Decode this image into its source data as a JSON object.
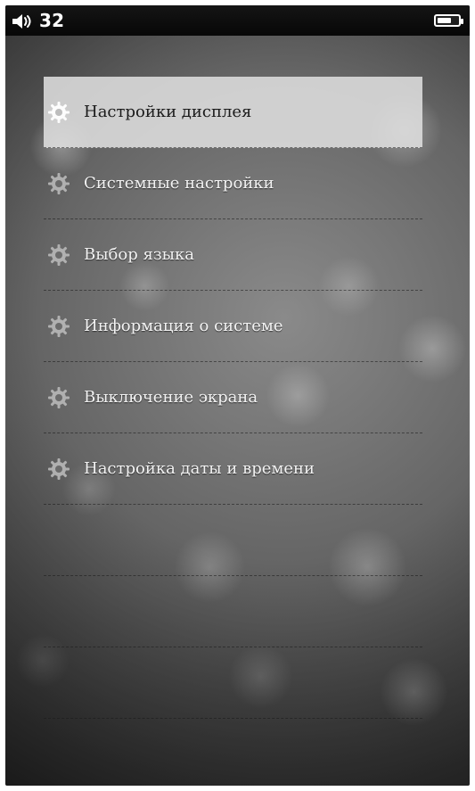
{
  "status_bar": {
    "volume_level": "32",
    "icons": {
      "speaker": "speaker-icon",
      "battery": "battery-icon"
    },
    "battery_fill_fraction": 0.7
  },
  "menu": {
    "items": [
      {
        "label": "Настройки дисплея",
        "icon": "gear-icon",
        "selected": true
      },
      {
        "label": "Системные настройки",
        "icon": "gear-icon",
        "selected": false
      },
      {
        "label": "Выбор языка",
        "icon": "gear-icon",
        "selected": false
      },
      {
        "label": "Информация о системе",
        "icon": "gear-icon",
        "selected": false
      },
      {
        "label": "Выключение экрана",
        "icon": "gear-icon",
        "selected": false
      },
      {
        "label": "Настройка даты и времени",
        "icon": "gear-icon",
        "selected": false
      }
    ],
    "empty_rows_visible": 3
  },
  "colors": {
    "selected_background": "#dedede",
    "selected_text": "#1b1b1b",
    "text": "#f3f3f3",
    "status_bar_background": "#0b0b0b"
  }
}
